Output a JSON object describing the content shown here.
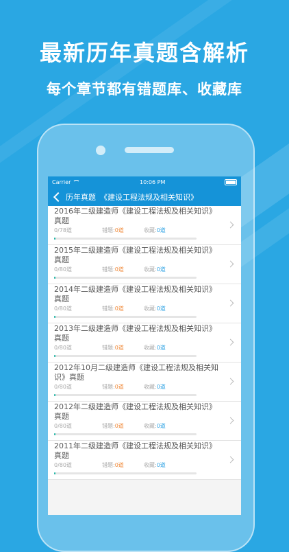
{
  "banner": {
    "headline": "最新历年真题含解析",
    "subline": "每个章节都有错题库、收藏库"
  },
  "status_bar": {
    "carrier": "Carrier",
    "time": "10:06 PM"
  },
  "nav": {
    "back_label": "历年真题",
    "title": "《建设工程法规及相关知识》"
  },
  "items": [
    {
      "title": "2016年二级建造师《建设工程法规及相关知识》真题",
      "progress": "0/78道",
      "wrong_label": "错题:",
      "wrong_count": "0道",
      "fav_label": "收藏:",
      "fav_count": "0道"
    },
    {
      "title": "2015年二级建造师《建设工程法规及相关知识》真题",
      "progress": "0/80道",
      "wrong_label": "错题:",
      "wrong_count": "0道",
      "fav_label": "收藏:",
      "fav_count": "0道"
    },
    {
      "title": "2014年二级建造师《建设工程法规及相关知识》真题",
      "progress": "0/80道",
      "wrong_label": "错题:",
      "wrong_count": "0道",
      "fav_label": "收藏:",
      "fav_count": "0道"
    },
    {
      "title": "2013年二级建造师《建设工程法规及相关知识》真题",
      "progress": "0/80道",
      "wrong_label": "错题:",
      "wrong_count": "0道",
      "fav_label": "收藏:",
      "fav_count": "0道"
    },
    {
      "title": "2012年10月二级建造师《建设工程法规及相关知识》真题",
      "progress": "0/80道",
      "wrong_label": "错题:",
      "wrong_count": "0道",
      "fav_label": "收藏:",
      "fav_count": "0道"
    },
    {
      "title": "2012年二级建造师《建设工程法规及相关知识》真题",
      "progress": "0/80道",
      "wrong_label": "错题:",
      "wrong_count": "0道",
      "fav_label": "收藏:",
      "fav_count": "0道"
    },
    {
      "title": "2011年二级建造师《建设工程法规及相关知识》真题",
      "progress": "0/80道",
      "wrong_label": "错题:",
      "wrong_count": "0道",
      "fav_label": "收藏:",
      "fav_count": "0道"
    }
  ],
  "colors": {
    "background": "#2aa7e3",
    "nav": "#1593d8",
    "wrong": "#f08a3a",
    "favorite": "#33a4e4",
    "progress": "#1fb6a6"
  }
}
